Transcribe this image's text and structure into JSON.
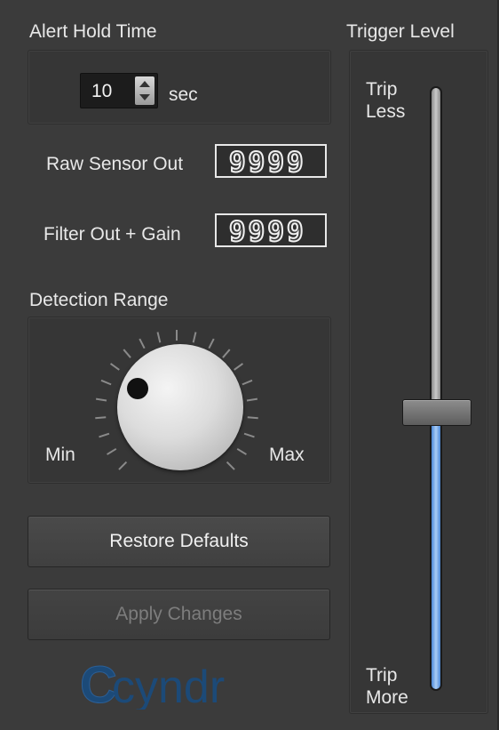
{
  "alert_hold": {
    "title": "Alert Hold Time",
    "value": "10",
    "unit": "sec"
  },
  "raw_sensor": {
    "label": "Raw Sensor Out",
    "display": "9999"
  },
  "filter_out": {
    "label": "Filter Out + Gain",
    "display": "9999"
  },
  "detection": {
    "title": "Detection Range",
    "min_label": "Min",
    "max_label": "Max"
  },
  "buttons": {
    "restore": "Restore Defaults",
    "apply": "Apply Changes"
  },
  "logo_text": "cyndr",
  "trigger": {
    "title": "Trigger Level",
    "top_label_1": "Trip",
    "top_label_2": "Less",
    "bottom_label_1": "Trip",
    "bottom_label_2": "More",
    "level_fraction": 0.46
  },
  "colors": {
    "accent_blue": "#6fa8ec",
    "logo_blue": "#1c4a78"
  }
}
